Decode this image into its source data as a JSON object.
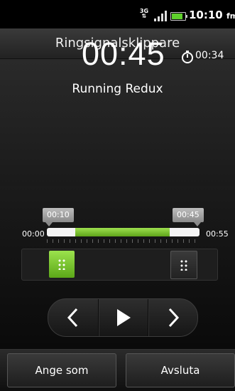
{
  "statusbar": {
    "network": "3G",
    "time": "10:10",
    "time_suffix": "fm"
  },
  "header": {
    "title": "Ringsignalsklippare"
  },
  "clip": {
    "length": "00:45",
    "duration": "00:34",
    "song": "Running Redux"
  },
  "trim": {
    "start_tag": "00:10",
    "end_tag": "00:45",
    "min_label": "00:00",
    "max_label": "00:55",
    "selected_fraction": [
      0.18,
      0.82
    ]
  },
  "actions": {
    "set_as": "Ange som",
    "exit": "Avsluta"
  },
  "icons": {
    "stopwatch": "stopwatch-icon",
    "prev": "chevron-left-icon",
    "play": "play-icon",
    "next": "chevron-right-icon"
  },
  "colors": {
    "accent": "#7cc42f"
  }
}
